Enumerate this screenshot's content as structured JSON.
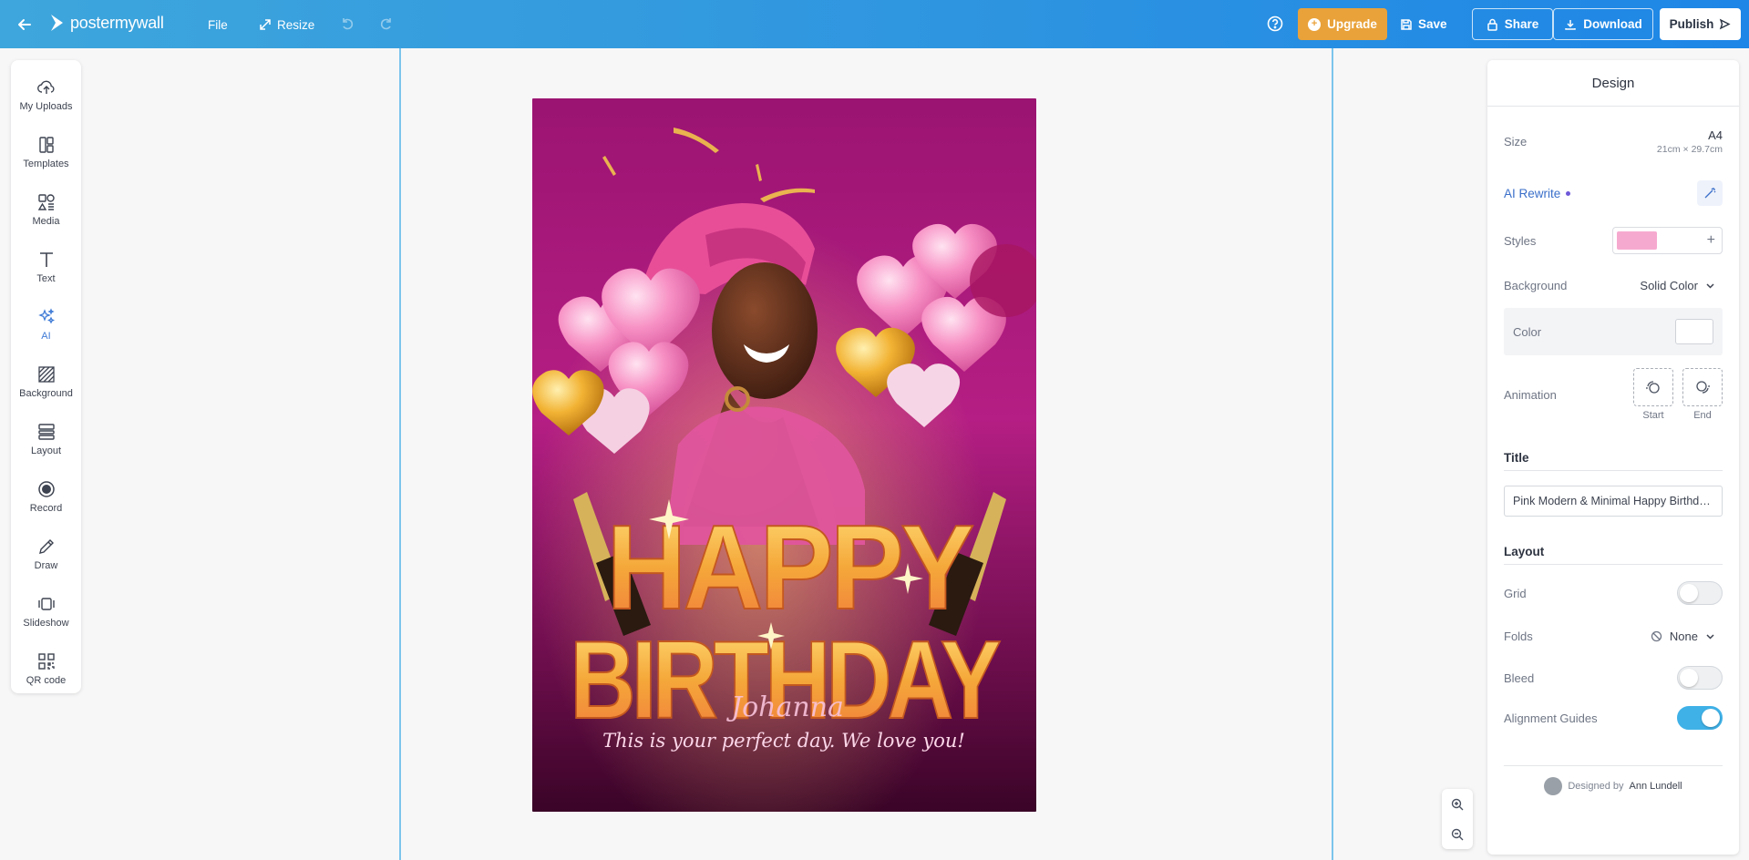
{
  "app": {
    "logo_text": "postermywall"
  },
  "topbar": {
    "file_label": "File",
    "resize_label": "Resize",
    "upgrade_label": "Upgrade",
    "save_label": "Save",
    "share_label": "Share",
    "download_label": "Download",
    "publish_label": "Publish"
  },
  "tools": [
    {
      "label": "My Uploads",
      "icon": "cloud-upload-icon"
    },
    {
      "label": "Templates",
      "icon": "templates-icon"
    },
    {
      "label": "Media",
      "icon": "media-icon"
    },
    {
      "label": "Text",
      "icon": "text-icon"
    },
    {
      "label": "AI",
      "icon": "sparkles-icon",
      "active": true
    },
    {
      "label": "Background",
      "icon": "background-icon"
    },
    {
      "label": "Layout",
      "icon": "layout-icon"
    },
    {
      "label": "Record",
      "icon": "record-icon"
    },
    {
      "label": "Draw",
      "icon": "pencil-icon"
    },
    {
      "label": "Slideshow",
      "icon": "slideshow-icon"
    },
    {
      "label": "QR code",
      "icon": "qr-code-icon"
    }
  ],
  "poster": {
    "headline_1": "HAPPY",
    "headline_2": "BIRTHDAY",
    "name": "Johanna",
    "tagline": "This is your perfect day. We love you!"
  },
  "panel": {
    "title": "Design",
    "size_label": "Size",
    "size_value": "A4",
    "size_dims": "21cm × 29.7cm",
    "ai_rewrite_label": "AI Rewrite",
    "styles_label": "Styles",
    "style_swatch_color": "#f6a9cf",
    "background_label": "Background",
    "background_value": "Solid Color",
    "color_label": "Color",
    "color_value": "#ffffff",
    "animation_label": "Animation",
    "anim_start": "Start",
    "anim_end": "End",
    "title_section": "Title",
    "title_value": "Pink Modern & Minimal Happy Birthday Poster",
    "layout_section": "Layout",
    "grid_label": "Grid",
    "grid_on": false,
    "folds_label": "Folds",
    "folds_value": "None",
    "bleed_label": "Bleed",
    "bleed_on": false,
    "guides_label": "Alignment Guides",
    "guides_on": true,
    "designed_by_prefix": "Designed by",
    "designer": "Ann Lundell"
  },
  "colors": {
    "topbar": "#2e95e0",
    "upgrade": "#e9a23a",
    "accent": "#3fb1e7",
    "guide": "#7cc5ec"
  }
}
